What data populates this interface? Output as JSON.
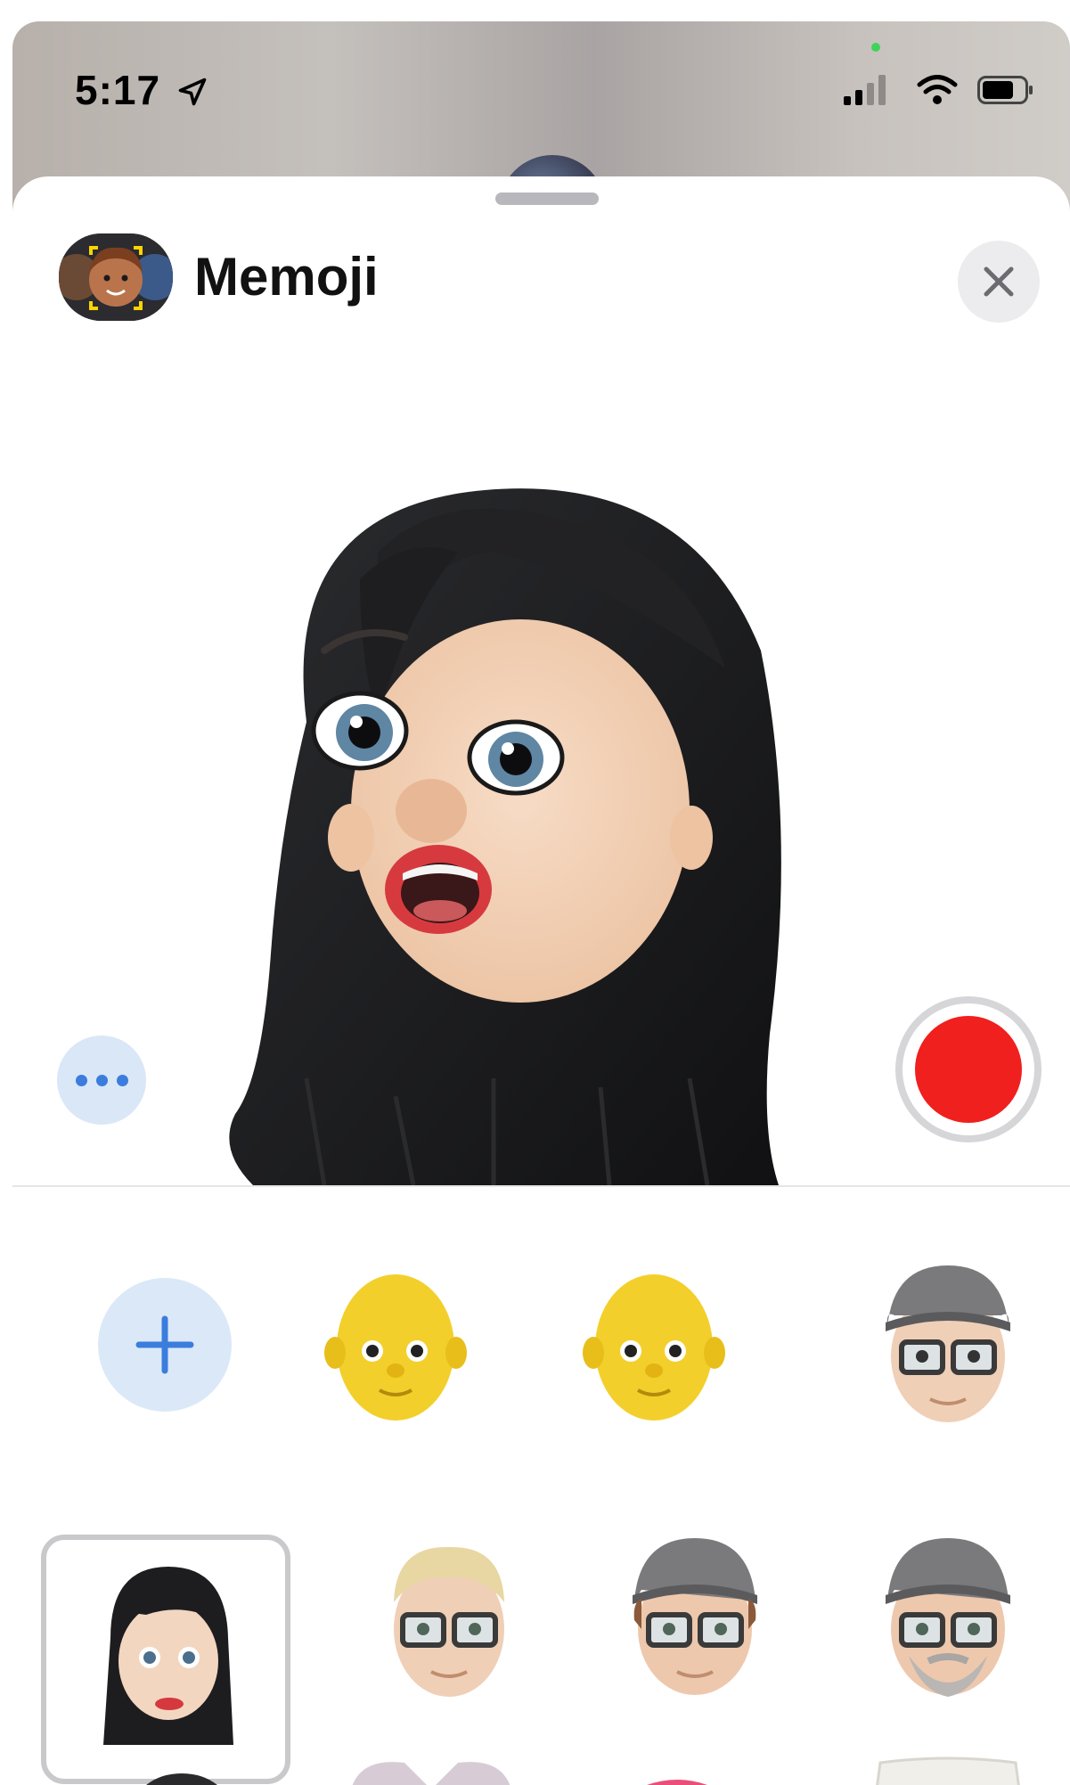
{
  "status": {
    "time": "5:17"
  },
  "header": {
    "title": "Memoji"
  },
  "stickers": [
    {
      "name": "add"
    },
    {
      "name": "yellow-bald"
    },
    {
      "name": "yellow-bald-2"
    },
    {
      "name": "cap-glasses"
    },
    {
      "name": "black-hair-woman",
      "selected": true
    },
    {
      "name": "blonde-glasses"
    },
    {
      "name": "cap-glasses-2"
    },
    {
      "name": "cap-glasses-beard"
    },
    {
      "name": "dark-hair-partial"
    },
    {
      "name": "bunny-partial"
    },
    {
      "name": "pink-partial"
    },
    {
      "name": "white-partial"
    }
  ],
  "colors": {
    "record": "#f0201e",
    "accent": "#3b7ddd",
    "button_bg": "#dbe8f7"
  },
  "icons": [
    "location-arrow-icon",
    "signal-icon",
    "wifi-icon",
    "battery-icon",
    "close-icon",
    "more-icon",
    "plus-icon",
    "record-icon"
  ]
}
